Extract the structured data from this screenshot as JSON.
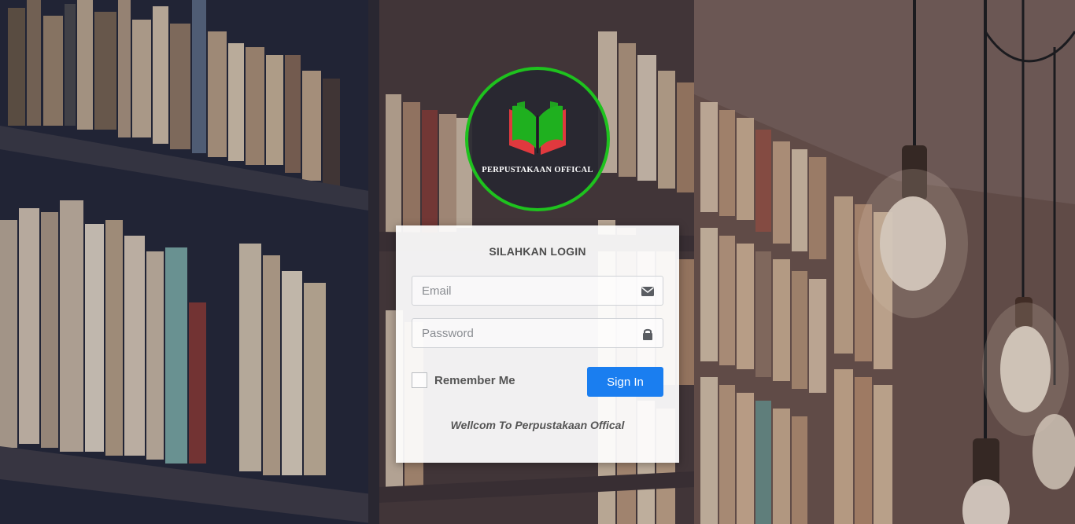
{
  "logo": {
    "text": "PERPUSTAKAAN OFFICAL",
    "ring_color": "#1ec21e",
    "book_colors": [
      "#e0393e",
      "#1fb01f"
    ]
  },
  "login": {
    "title": "SILAHKAN LOGIN",
    "email_placeholder": "Email",
    "email_icon": "envelope-icon",
    "password_placeholder": "Password",
    "password_icon": "lock-icon",
    "remember_label": "Remember Me",
    "remember_checked": false,
    "signin_label": "Sign In",
    "welcome_text": "Wellcom To Perpustakaan Offical"
  },
  "colors": {
    "primary_button": "#1a7ef0",
    "card_background": "#ffffff"
  }
}
